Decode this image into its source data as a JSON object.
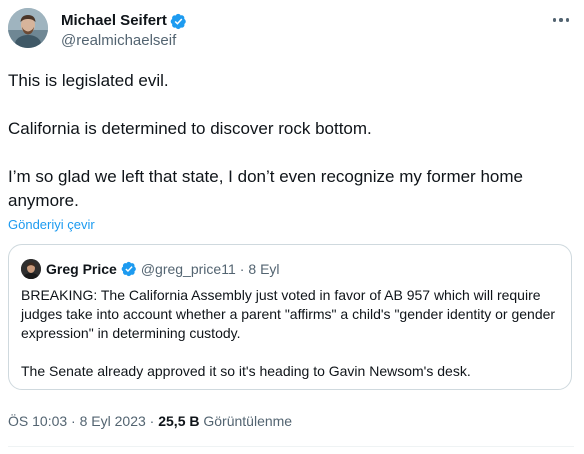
{
  "author": {
    "name": "Michael Seifert",
    "handle": "@realmichaelseif",
    "verified": true
  },
  "tweet": {
    "paragraphs": [
      "This is legislated evil.",
      "California is determined to discover rock bottom.",
      "I’m so glad we left that state, I don’t even recognize my former home anymore."
    ],
    "translate_label": "Gönderiyi çevir"
  },
  "quoted_tweet": {
    "name": "Greg Price",
    "handle": "@greg_price11",
    "separator": "·",
    "date": "8 Eyl",
    "verified": true,
    "paragraphs": [
      "BREAKING: The California Assembly just voted in favor of AB 957 which will require judges take into account whether a parent \"affirms\" a child's \"gender identity or gender expression\" in determining custody.",
      "The Senate already approved it so it's heading to Gavin Newsom's desk."
    ]
  },
  "meta": {
    "time": "ÖS 10:03",
    "separator": "·",
    "date": "8 Eyl 2023",
    "views_count": "25,5 B",
    "views_label": "Görüntülenme"
  },
  "colors": {
    "accent": "#1d9bf0",
    "secondary_text": "#536471",
    "primary_text": "#0f1419",
    "border": "#cfd9de"
  },
  "icons": {
    "verified": "verified-badge-icon",
    "more": "more-options-icon"
  }
}
